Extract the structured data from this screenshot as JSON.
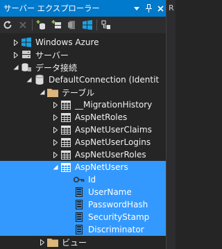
{
  "window": {
    "title": "サーバー エクスプローラー",
    "right_tab_label": "R"
  },
  "toolbar": {
    "buttons": [
      "refresh-icon",
      "stop-icon",
      "connect-database-icon",
      "connect-server-icon",
      "sharepoint-icon",
      "azure-icon",
      "properties-icon"
    ]
  },
  "tree": {
    "azure": "Windows Azure",
    "servers": "サーバー",
    "data_connections": "データ接続",
    "connection": "DefaultConnection (Identit",
    "tables_folder": "テーブル",
    "tables": [
      "__MigrationHistory",
      "AspNetRoles",
      "AspNetUserClaims",
      "AspNetUserLogins",
      "AspNetUserRoles",
      "AspNetUsers"
    ],
    "columns": [
      "Id",
      "UserName",
      "PasswordHash",
      "SecurityStamp",
      "Discriminator"
    ],
    "views_folder": "ビュー"
  },
  "colors": {
    "title_bar": "#007acc",
    "selection": "#3399ff",
    "background": "#252526",
    "toolbar": "#2d2d30"
  }
}
